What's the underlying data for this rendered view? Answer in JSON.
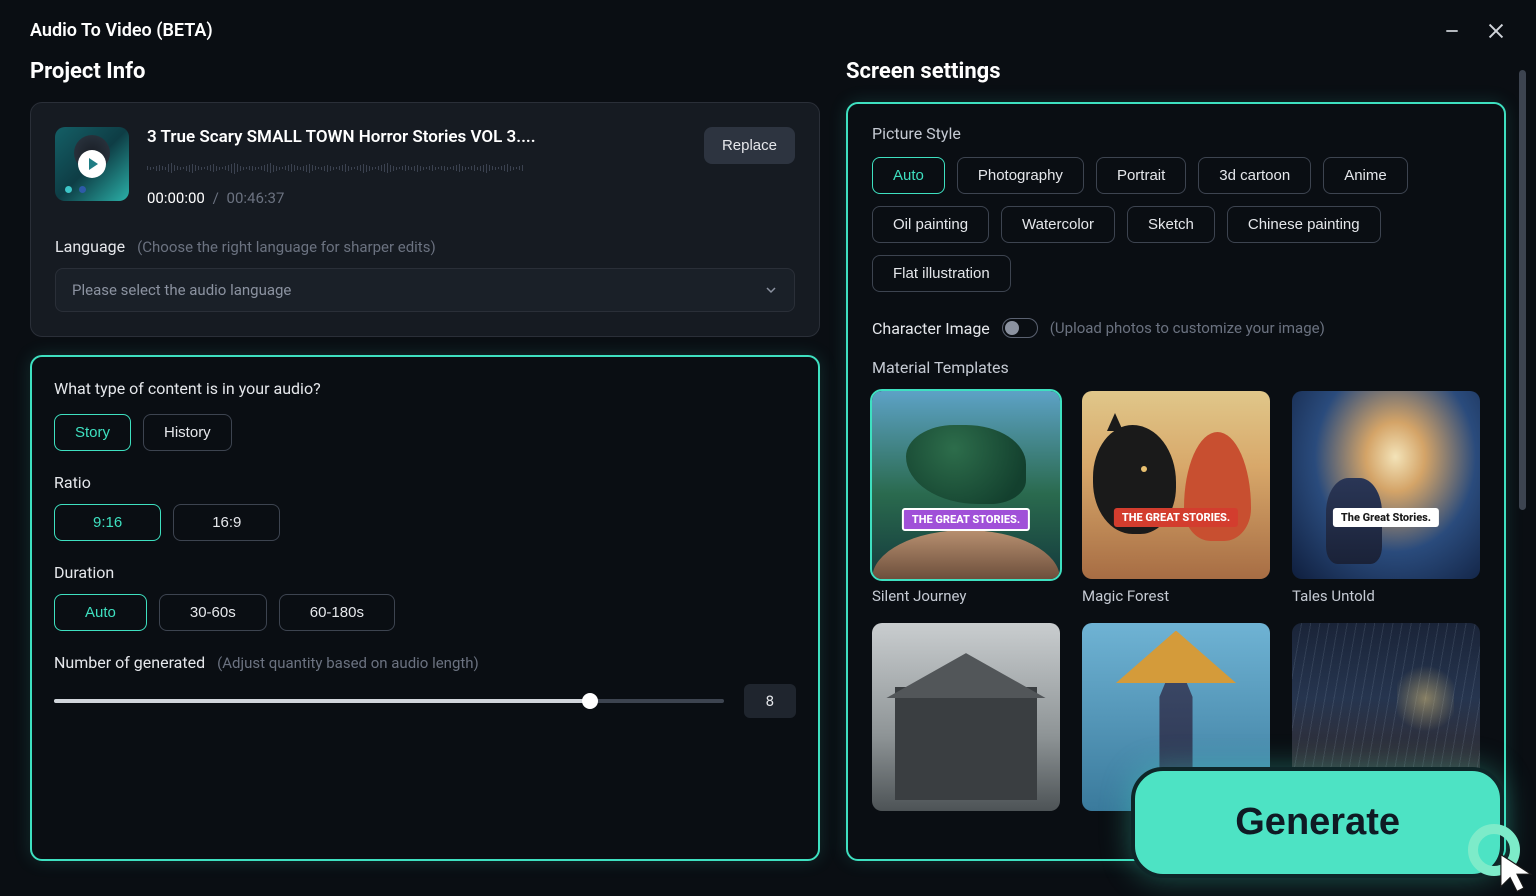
{
  "window": {
    "title": "Audio To Video (BETA)"
  },
  "project": {
    "section_title": "Project Info",
    "audio_title": "3 True Scary SMALL TOWN Horror Stories  VOL 3....",
    "replace_label": "Replace",
    "current_time": "00:00:00",
    "sep": "/",
    "total_time": "00:46:37",
    "language_label": "Language",
    "language_hint": "(Choose the right language for sharper edits)",
    "language_placeholder": "Please select the audio language"
  },
  "content": {
    "question": "What type of content is in your audio?",
    "types": [
      "Story",
      "History"
    ],
    "selected_type": "Story",
    "ratio_label": "Ratio",
    "ratios": [
      "9:16",
      "16:9"
    ],
    "selected_ratio": "9:16",
    "duration_label": "Duration",
    "durations": [
      "Auto",
      "30-60s",
      "60-180s"
    ],
    "selected_duration": "Auto",
    "count_label": "Number of generated",
    "count_hint": "(Adjust quantity based on audio length)",
    "count_value": "8"
  },
  "screen": {
    "section_title": "Screen settings",
    "style_label": "Picture Style",
    "styles": [
      "Auto",
      "Photography",
      "Portrait",
      "3d cartoon",
      "Anime",
      "Oil painting",
      "Watercolor",
      "Sketch",
      "Chinese painting",
      "Flat illustration"
    ],
    "selected_style": "Auto",
    "char_image_label": "Character Image",
    "char_image_hint": "(Upload photos to customize your image)",
    "templates_label": "Material Templates",
    "templates": [
      {
        "caption": "Silent Journey",
        "badge": "THE GREAT STORIES."
      },
      {
        "caption": "Magic Forest",
        "badge": "THE GREAT STORIES."
      },
      {
        "caption": "Tales Untold",
        "badge": "The Great Stories."
      }
    ],
    "selected_template": 0
  },
  "generate_label": "Generate"
}
